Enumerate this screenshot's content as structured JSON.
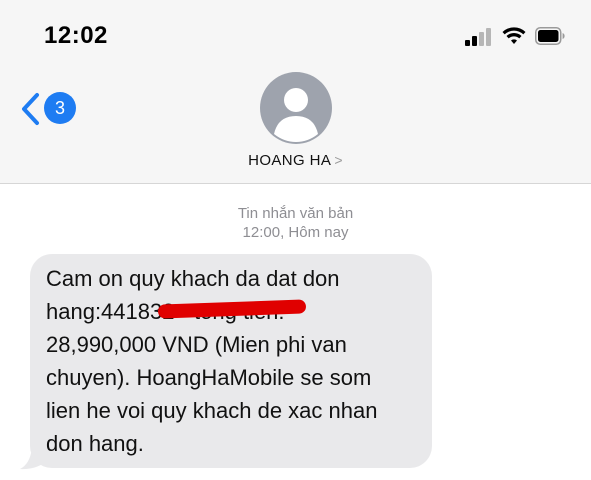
{
  "status_bar": {
    "time": "12:02",
    "icons": [
      "cellular-signal-icon",
      "wifi-icon",
      "battery-icon"
    ]
  },
  "nav": {
    "back_badge": "3",
    "contact_name": "HOANG HA",
    "contact_chevron": ">"
  },
  "thread": {
    "service_label": "Tin nhắn văn bản",
    "timestamp": "12:00, Hôm nay"
  },
  "message": {
    "text": "Cam on quy khach da dat don\nhang:441832 - tong tien:\n28,990,000 VND (Mien phi van\nchuyen). HoangHaMobile se som\nlien he voi quy khach de xac nhan\ndon hang."
  },
  "colors": {
    "accent": "#1e7cf2",
    "bubble": "#e9e9eb",
    "header_bg": "#f6f6f6",
    "redaction": "#e00000"
  }
}
